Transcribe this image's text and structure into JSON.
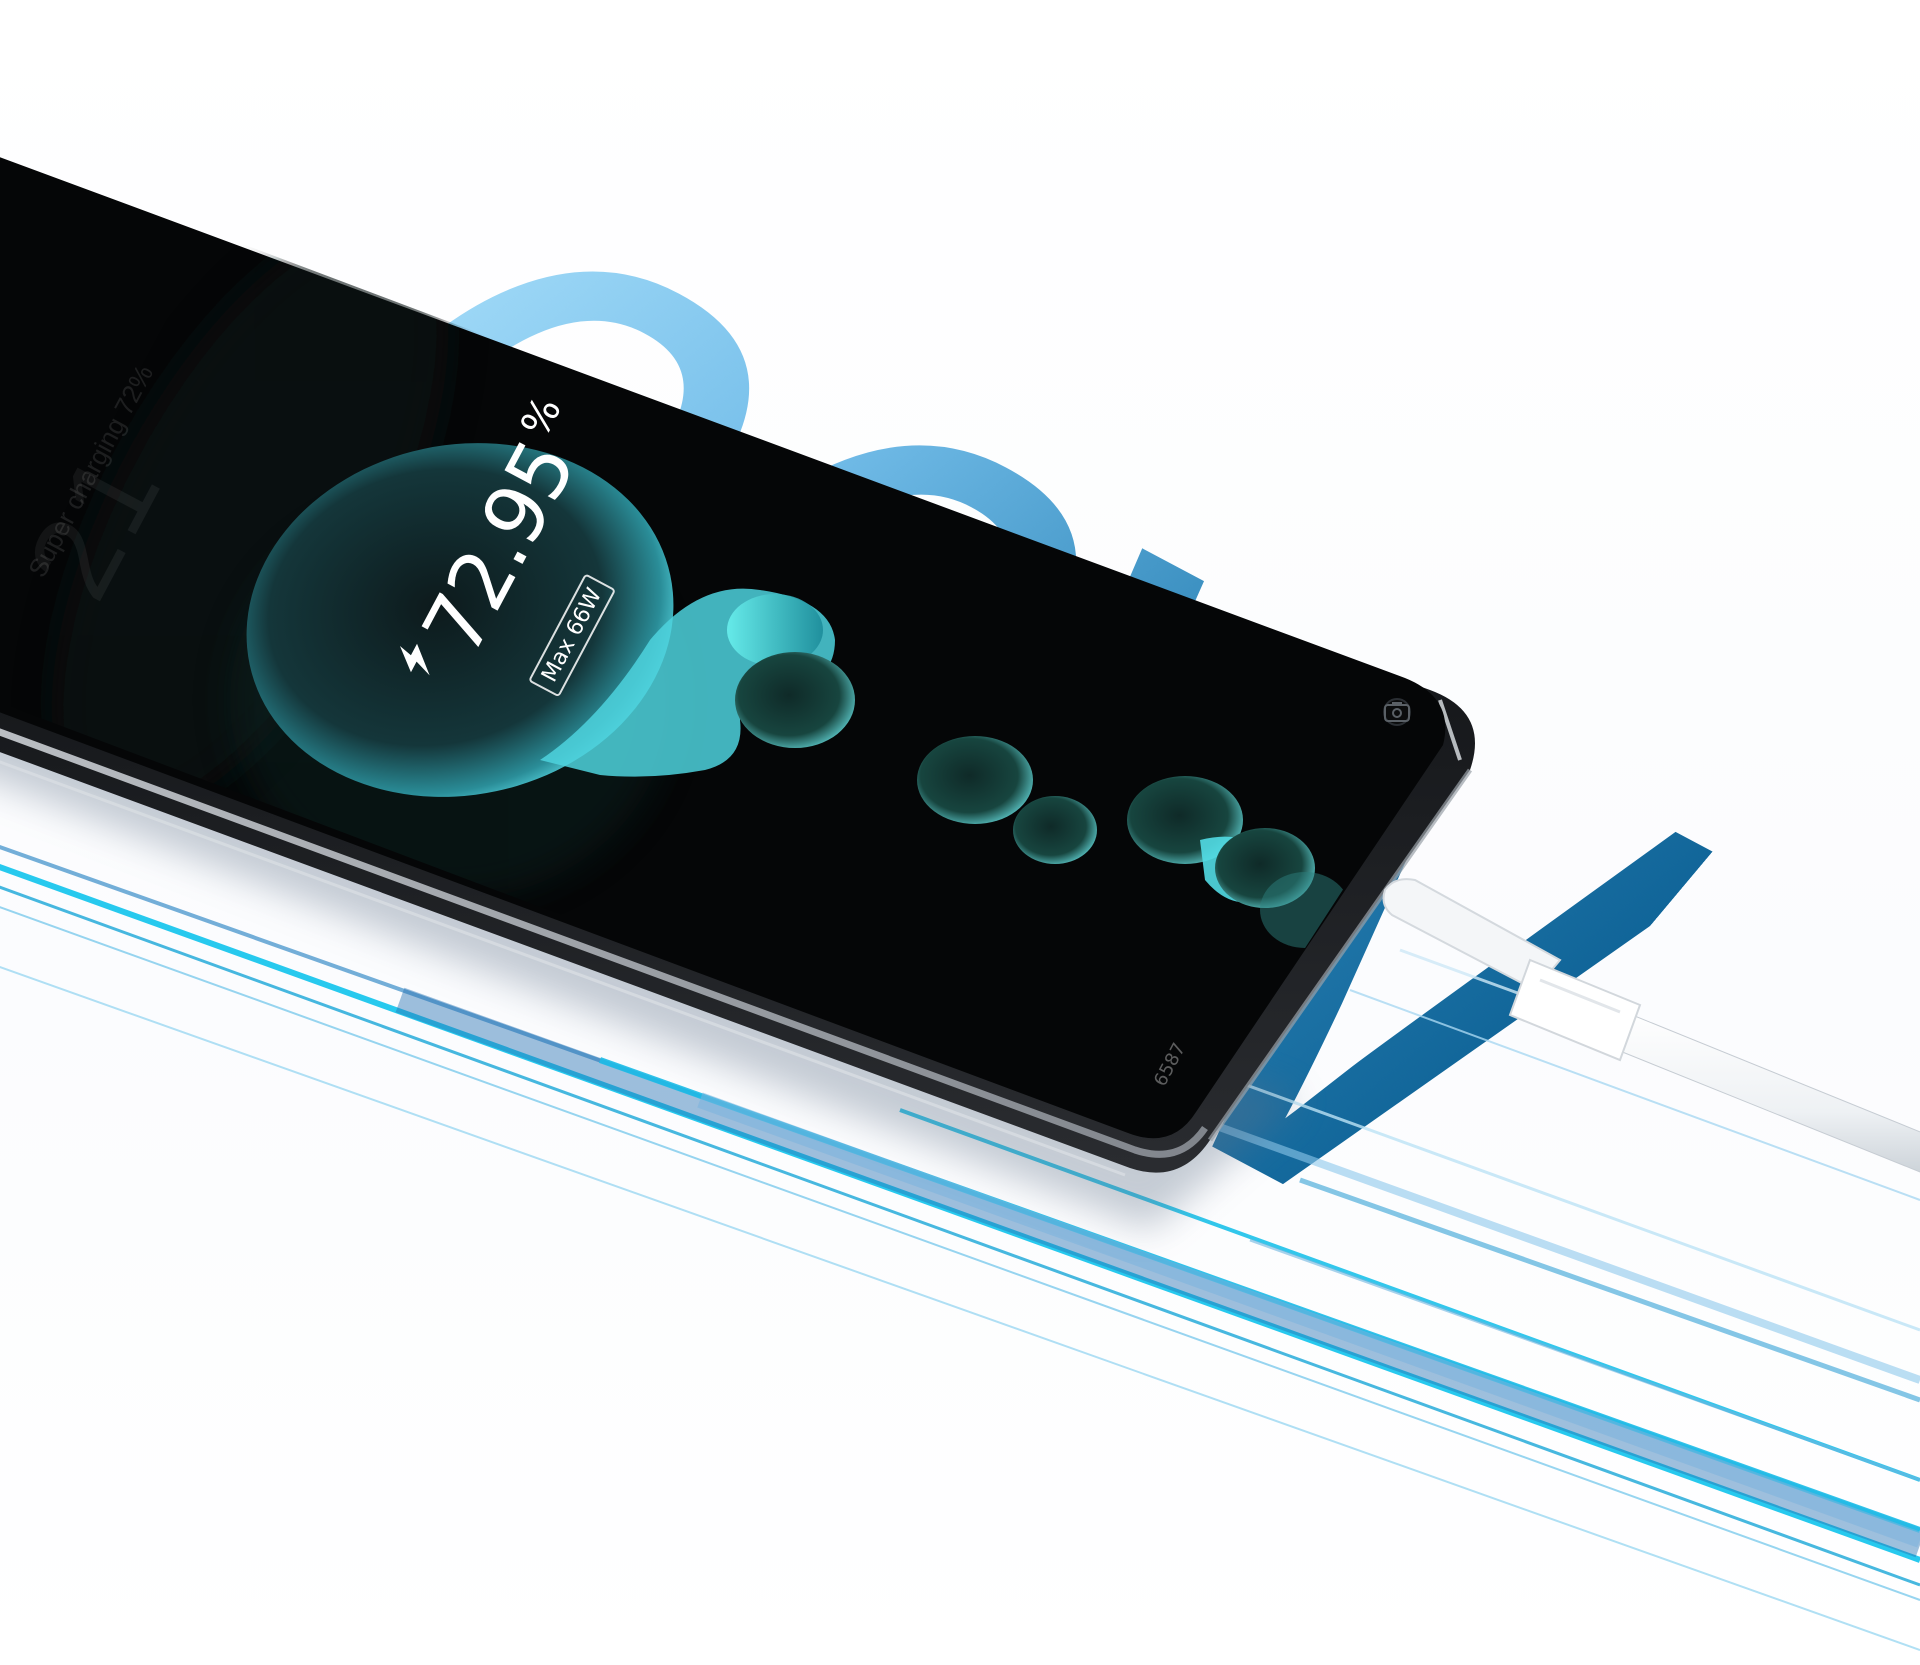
{
  "hero": {
    "label": "66W"
  },
  "phone": {
    "charge": {
      "percent_value": "72.95",
      "percent_sign": "%",
      "max_badge": "Max 66W"
    },
    "lock_screen": {
      "time": "21",
      "status": "Super charging 72%"
    },
    "model_tag": "6587"
  },
  "colors": {
    "hero_light": "#a6ddf9",
    "hero_dark": "#0b5f93",
    "streak_cyan": "#19c4ea",
    "streak_blue": "#2e7fbf",
    "screen_black": "#050607",
    "bubble_teal": "#4ed2dd"
  },
  "icons": [
    "bolt-icon",
    "camera-icon",
    "charging-cable"
  ]
}
